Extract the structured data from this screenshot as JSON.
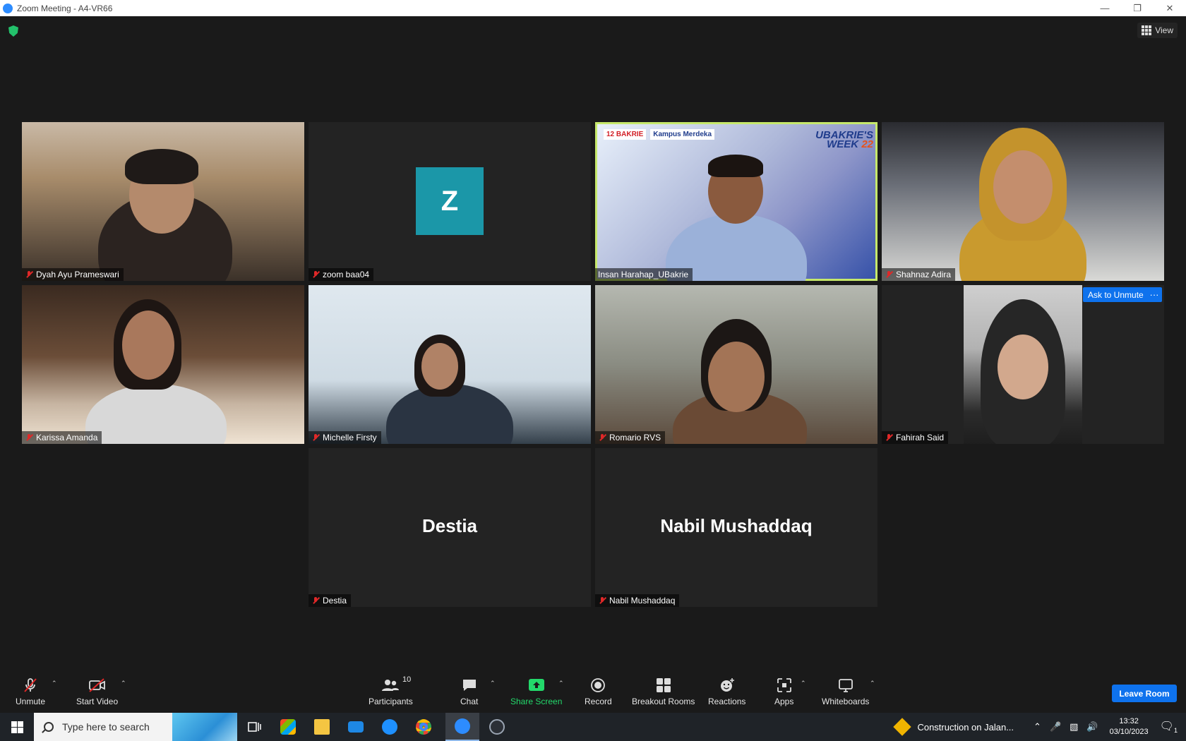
{
  "window": {
    "title": "Zoom Meeting - A4-VR66",
    "controls": [
      "—",
      "❐",
      "✕"
    ]
  },
  "top_bar": {
    "view_label": "View"
  },
  "tiles": [
    {
      "name": "Dyah Ayu Prameswari",
      "muted": true
    },
    {
      "name": "zoom baa04",
      "muted": true,
      "avatar_letter": "Z"
    },
    {
      "name": "Insan Harahap_UBakrie",
      "muted": false,
      "speaking": true,
      "overlay": {
        "logo1": "12 BAKRIE",
        "logo2": "Kampus Merdeka",
        "event_line1": "UBAKRIE'S",
        "event_line2": "WEEK",
        "event_num": "22"
      }
    },
    {
      "name": "Shahnaz Adira",
      "muted": true
    },
    {
      "name": "Karissa Amanda",
      "muted": true
    },
    {
      "name": "Michelle Firsty",
      "muted": true
    },
    {
      "name": "Romario RVS",
      "muted": true
    },
    {
      "name": "Fahirah Said",
      "muted": true
    },
    {
      "name": "Destia",
      "muted": true,
      "display_name": "Destia"
    },
    {
      "name": "Nabil Mushaddaq",
      "muted": true,
      "display_name": "Nabil Mushaddaq"
    }
  ],
  "hover_actions": {
    "ask_unmute": "Ask to Unmute",
    "more": "···"
  },
  "toolbar": {
    "unmute": "Unmute",
    "start_video": "Start Video",
    "participants": "Participants",
    "participants_count": "10",
    "chat": "Chat",
    "share_screen": "Share Screen",
    "record": "Record",
    "breakout_rooms": "Breakout Rooms",
    "reactions": "Reactions",
    "apps": "Apps",
    "whiteboards": "Whiteboards",
    "leave_room": "Leave Room",
    "caret": "⌃"
  },
  "taskbar": {
    "search_placeholder": "Type here to search",
    "notification": "Construction on Jalan...",
    "time": "13:32",
    "date": "03/10/2023",
    "notif_count": "1"
  }
}
